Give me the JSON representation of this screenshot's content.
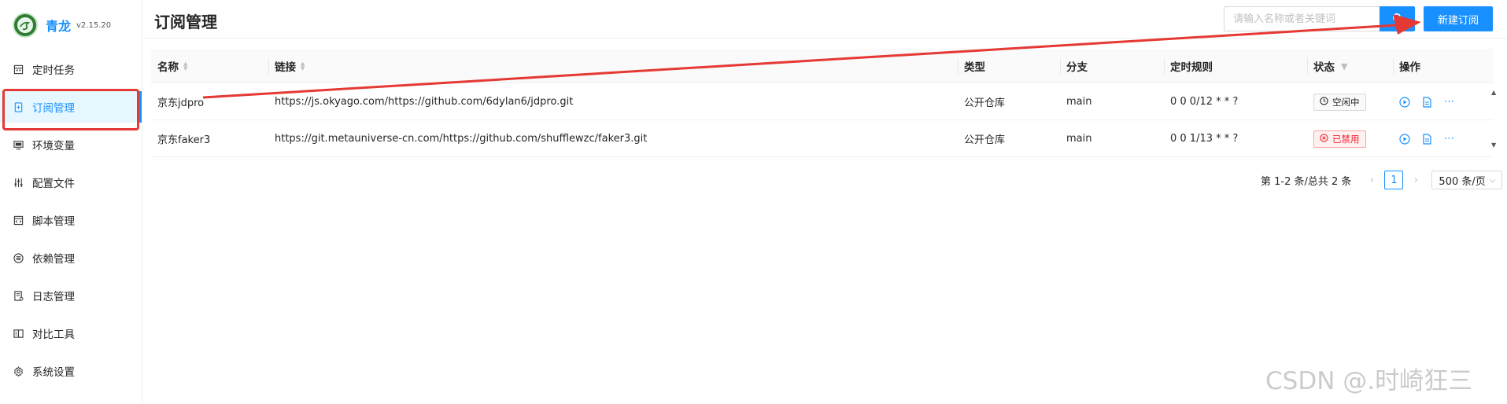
{
  "brand": {
    "name": "青龙",
    "version": "v2.15.20",
    "logo_icon": "qinglong-dragon-logo"
  },
  "sidebar": {
    "items": [
      {
        "label": "定时任务",
        "icon": "calendar-icon"
      },
      {
        "label": "订阅管理",
        "icon": "subscription-icon",
        "active": true
      },
      {
        "label": "环境变量",
        "icon": "desktop-icon"
      },
      {
        "label": "配置文件",
        "icon": "sliders-icon"
      },
      {
        "label": "脚本管理",
        "icon": "code-file-icon"
      },
      {
        "label": "依赖管理",
        "icon": "list-circle-icon"
      },
      {
        "label": "日志管理",
        "icon": "log-file-icon"
      },
      {
        "label": "对比工具",
        "icon": "diff-icon"
      },
      {
        "label": "系统设置",
        "icon": "gear-icon"
      }
    ]
  },
  "header": {
    "title": "订阅管理",
    "search_placeholder": "请输入名称或者关键词",
    "new_button": "新建订阅"
  },
  "table": {
    "columns": [
      "名称",
      "链接",
      "类型",
      "分支",
      "定时规则",
      "状态",
      "操作"
    ],
    "rows": [
      {
        "name": "京东jdpro",
        "url": "https://js.okyago.com/https://github.com/6dylan6/jdpro.git",
        "type": "公开仓库",
        "branch": "main",
        "schedule": "0 0 0/12 * * ?",
        "status": "空闲中",
        "status_kind": "idle"
      },
      {
        "name": "京东faker3",
        "url": "https://git.metauniverse-cn.com/https://github.com/shufflewzc/faker3.git",
        "type": "公开仓库",
        "branch": "main",
        "schedule": "0 0 1/13 * * ?",
        "status": "已禁用",
        "status_kind": "disabled"
      }
    ]
  },
  "pagination": {
    "total_text": "第 1-2 条/总共 2 条",
    "current": "1",
    "page_size": "500 条/页"
  },
  "watermark": "CSDN @.时崎狂三",
  "colors": {
    "primary": "#1890ff",
    "annotation_red": "#e53935",
    "disabled_red": "#f5222d"
  }
}
